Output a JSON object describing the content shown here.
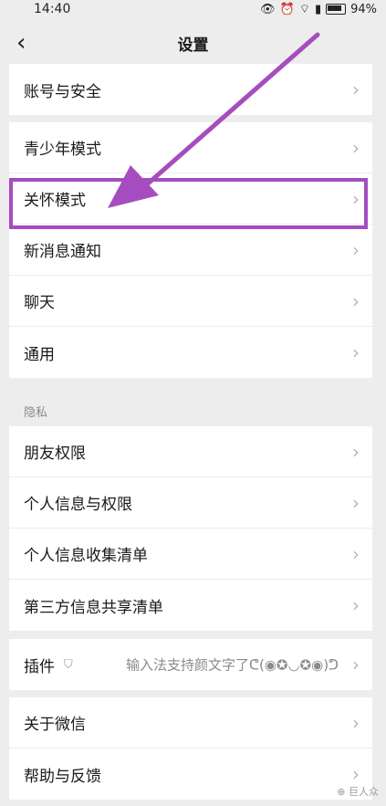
{
  "status": {
    "time": "14:40",
    "battery": "94%"
  },
  "title": "设置",
  "groups": [
    {
      "items": [
        {
          "label": "账号与安全"
        }
      ]
    },
    {
      "items": [
        {
          "label": "青少年模式"
        },
        {
          "label": "关怀模式"
        },
        {
          "label": "新消息通知"
        },
        {
          "label": "聊天"
        },
        {
          "label": "通用"
        }
      ]
    },
    {
      "items": [
        {
          "label": "朋友权限"
        },
        {
          "label": "个人信息与权限"
        },
        {
          "label": "个人信息收集清单"
        },
        {
          "label": "第三方信息共享清单"
        }
      ]
    },
    {
      "items": [
        {
          "label": "插件",
          "extra": "输入法支持颜文字了ᕦ(◉✪◡✪◉)ᕤ"
        }
      ]
    },
    {
      "items": [
        {
          "label": "关于微信"
        },
        {
          "label": "帮助与反馈"
        }
      ]
    }
  ],
  "privacy_header": "隐私",
  "watermark": "巨人众",
  "colors": {
    "highlight": "#a54dbf",
    "arrow": "#a54dbf"
  }
}
